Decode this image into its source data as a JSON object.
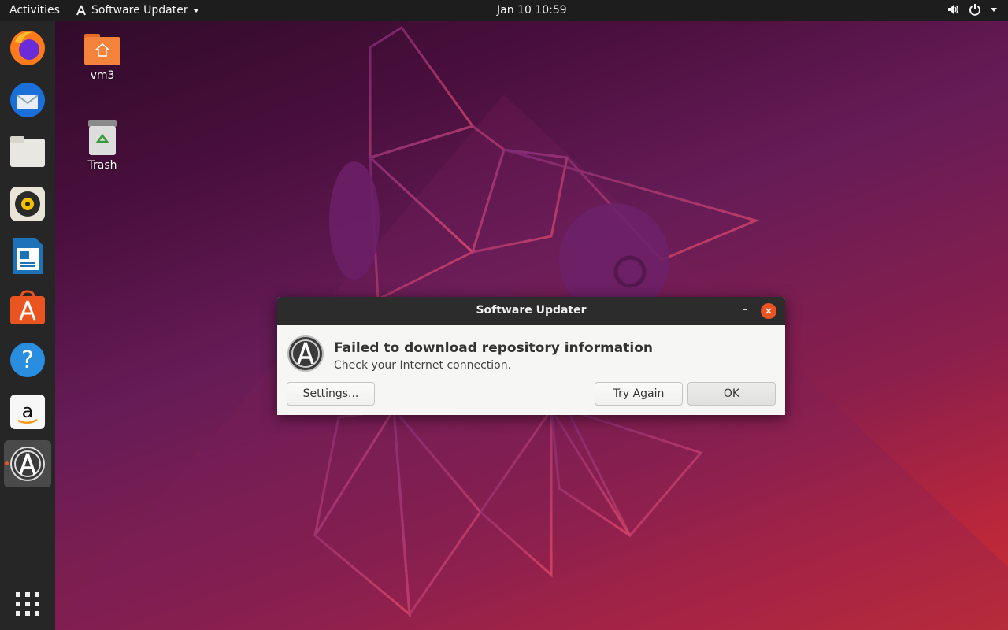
{
  "topbar": {
    "activities": "Activities",
    "app_name": "Software Updater",
    "clock": "Jan 10  10:59",
    "volume_icon": "volume-icon",
    "power_icon": "power-icon"
  },
  "dock": {
    "items": [
      "firefox",
      "thunderbird",
      "files",
      "rhythmbox",
      "libreoffice-writer",
      "ubuntu-software",
      "help",
      "amazon",
      "software-updater"
    ],
    "active": "software-updater",
    "show_apps": "show-applications"
  },
  "desktop": {
    "icons": [
      {
        "label": "vm3"
      },
      {
        "label": "Trash"
      }
    ]
  },
  "dialog": {
    "title": "Software Updater",
    "heading": "Failed to download repository information",
    "message": "Check your Internet connection.",
    "settings_button": "Settings...",
    "try_again_button": "Try Again",
    "ok_button": "OK",
    "minimize_glyph": "–"
  },
  "colors": {
    "accent": "#e95420",
    "topbar": "#1d1d1d",
    "dock": "#262626"
  }
}
